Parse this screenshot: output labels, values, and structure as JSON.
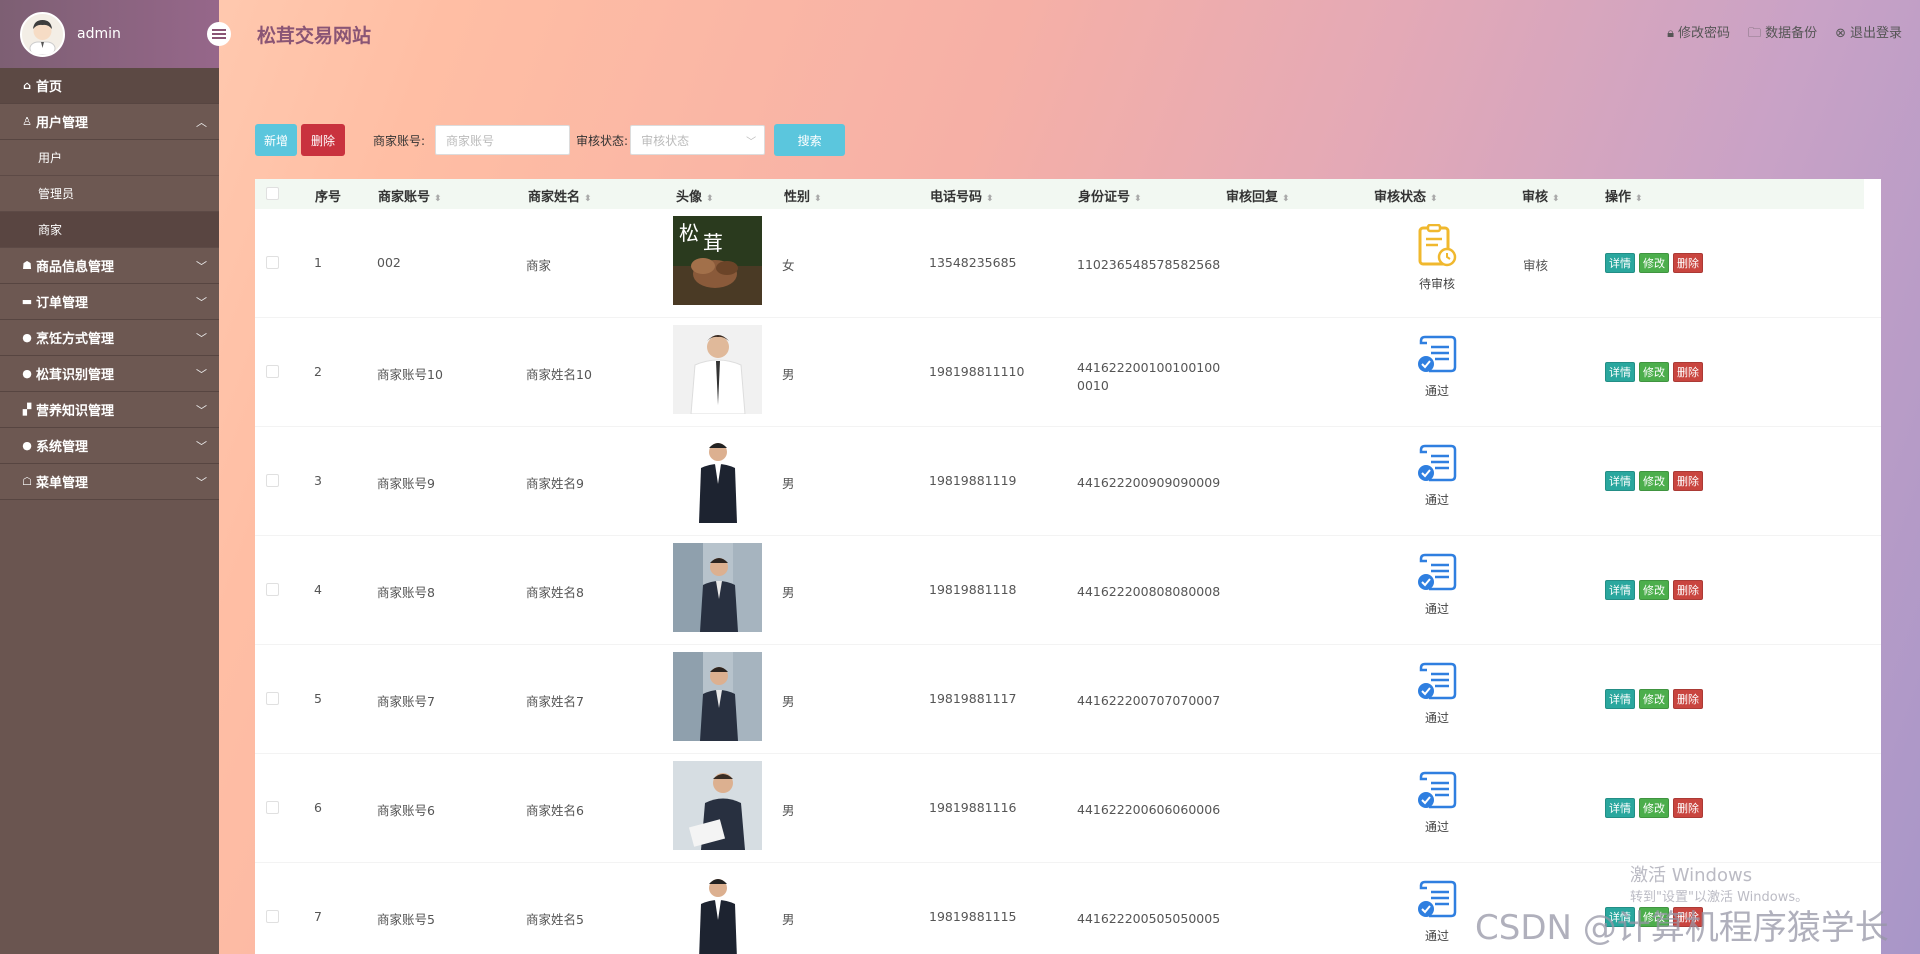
{
  "header": {
    "username": "admin",
    "site_title": "松茸交易网站",
    "actions": [
      {
        "label": "修改密码",
        "icon": "lock-icon"
      },
      {
        "label": "数据备份",
        "icon": "folder-icon"
      },
      {
        "label": "退出登录",
        "icon": "exit-icon"
      }
    ]
  },
  "sidebar": {
    "items": [
      {
        "label": "首页",
        "icon": "home-icon"
      },
      {
        "label": "用户管理",
        "icon": "user-icon",
        "expanded": true,
        "children": [
          {
            "label": "用户"
          },
          {
            "label": "管理员"
          },
          {
            "label": "商家",
            "active": true
          }
        ]
      },
      {
        "label": "商品信息管理",
        "icon": "goods-icon"
      },
      {
        "label": "订单管理",
        "icon": "order-icon"
      },
      {
        "label": "烹饪方式管理",
        "icon": "cook-icon"
      },
      {
        "label": "松茸识别管理",
        "icon": "mushroom-icon"
      },
      {
        "label": "营养知识管理",
        "icon": "knowledge-icon"
      },
      {
        "label": "系统管理",
        "icon": "system-icon"
      },
      {
        "label": "菜单管理",
        "icon": "menu-icon"
      }
    ]
  },
  "toolbar": {
    "add_label": "新增",
    "delete_label": "删除",
    "account_label": "商家账号:",
    "account_placeholder": "商家账号",
    "status_label": "审核状态:",
    "status_placeholder": "审核状态",
    "search_label": "搜索"
  },
  "table": {
    "columns": [
      "序号",
      "商家账号",
      "商家姓名",
      "头像",
      "性别",
      "电话号码",
      "身份证号",
      "审核回复",
      "审核状态",
      "审核",
      "操作"
    ],
    "rows": [
      {
        "no": "1",
        "account": "002",
        "name": "商家",
        "gender": "女",
        "phone": "13548235685",
        "id_no": "110236548578582568",
        "id_no2": "",
        "reply": "",
        "status": "待审核",
        "status_type": "pending",
        "audit": "审核",
        "avatar": "mushroom"
      },
      {
        "no": "2",
        "account": "商家账号10",
        "name": "商家姓名10",
        "gender": "男",
        "phone": "198198811110",
        "id_no": "441622200100100100",
        "id_no2": "0010",
        "reply": "",
        "status": "通过",
        "status_type": "pass",
        "audit": "",
        "avatar": "white-shirt"
      },
      {
        "no": "3",
        "account": "商家账号9",
        "name": "商家姓名9",
        "gender": "男",
        "phone": "19819881119",
        "id_no": "441622200909090009",
        "id_no2": "",
        "reply": "",
        "status": "通过",
        "status_type": "pass",
        "audit": "",
        "avatar": "suit-white"
      },
      {
        "no": "4",
        "account": "商家账号8",
        "name": "商家姓名8",
        "gender": "男",
        "phone": "19819881118",
        "id_no": "441622200808080008",
        "id_no2": "",
        "reply": "",
        "status": "通过",
        "status_type": "pass",
        "audit": "",
        "avatar": "suit-building"
      },
      {
        "no": "5",
        "account": "商家账号7",
        "name": "商家姓名7",
        "gender": "男",
        "phone": "19819881117",
        "id_no": "441622200707070007",
        "id_no2": "",
        "reply": "",
        "status": "通过",
        "status_type": "pass",
        "audit": "",
        "avatar": "suit-building"
      },
      {
        "no": "6",
        "account": "商家账号6",
        "name": "商家姓名6",
        "gender": "男",
        "phone": "19819881116",
        "id_no": "441622200606060006",
        "id_no2": "",
        "reply": "",
        "status": "通过",
        "status_type": "pass",
        "audit": "",
        "avatar": "suit-tablet"
      },
      {
        "no": "7",
        "account": "商家账号5",
        "name": "商家姓名5",
        "gender": "男",
        "phone": "19819881115",
        "id_no": "441622200505050005",
        "id_no2": "",
        "reply": "",
        "status": "通过",
        "status_type": "pass",
        "audit": "",
        "avatar": "suit-white"
      }
    ],
    "ops": {
      "detail": "详情",
      "edit": "修改",
      "delete": "删除"
    }
  },
  "watermarks": {
    "windows_line1": "激活 Windows",
    "windows_line2": "转到\"设置\"以激活 Windows。",
    "csdn": "CSDN @计算机程序猿学长"
  }
}
